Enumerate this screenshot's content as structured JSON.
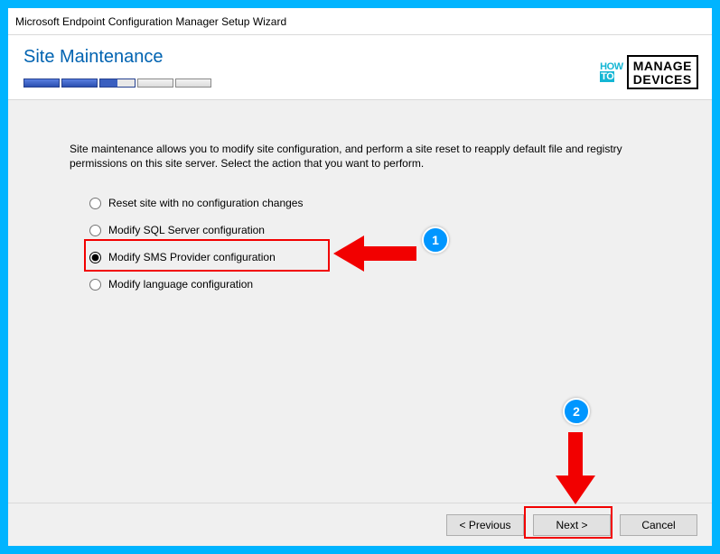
{
  "window": {
    "title": "Microsoft Endpoint Configuration Manager Setup Wizard"
  },
  "header": {
    "title": "Site Maintenance"
  },
  "logo": {
    "how": "HOW",
    "to": "TO",
    "line1": "MANAGE",
    "line2": "DEVICES"
  },
  "content": {
    "description": "Site maintenance allows you to modify site configuration, and perform a site reset to reapply default file and registry permissions on this site server.  Select the action that you want to perform."
  },
  "options": [
    {
      "label": "Reset site with no configuration changes",
      "selected": false
    },
    {
      "label": "Modify SQL Server configuration",
      "selected": false
    },
    {
      "label": "Modify SMS Provider configuration",
      "selected": true
    },
    {
      "label": "Modify language configuration",
      "selected": false
    }
  ],
  "footer": {
    "previous": "<  Previous",
    "next": "Next  >",
    "cancel": "Cancel"
  },
  "annotations": {
    "badge1": "1",
    "badge2": "2"
  }
}
